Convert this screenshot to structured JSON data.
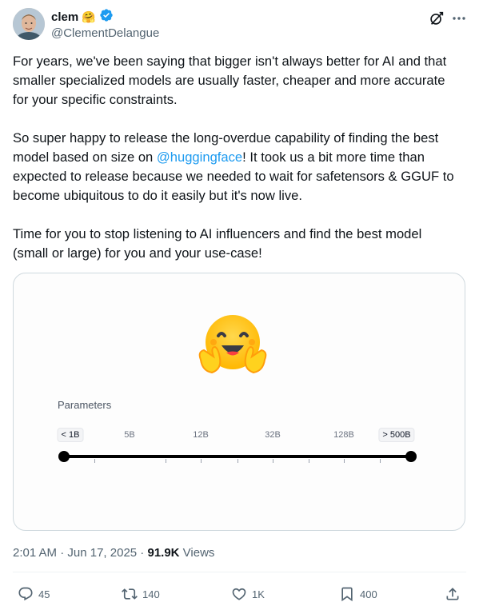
{
  "author": {
    "display_name": "clem",
    "emoji": "🤗",
    "handle": "@ClementDelangue",
    "verified": true
  },
  "tweet": {
    "paragraphs": [
      {
        "text": "For years, we've been saying that bigger isn't always better for AI and that smaller specialized models are usually faster, cheaper and more accurate for your specific constraints."
      },
      {
        "before": "So super happy to release the long-overdue capability of finding the best model based on size on ",
        "mention": "@huggingface",
        "after": "! It took us a bit more time than expected to release because we needed to wait for safetensors & GGUF to become ubiquitous to do it easily but it's now live."
      },
      {
        "text": "Time for you to stop listening to AI influencers and find the best model (small or large) for you and your use-case!"
      }
    ]
  },
  "media": {
    "title": "Parameters",
    "ticks": [
      "< 1B",
      "5B",
      "12B",
      "32B",
      "128B",
      "> 500B"
    ],
    "range_selected": [
      "< 1B",
      "> 500B"
    ]
  },
  "meta": {
    "time": "2:01 AM",
    "separator": " · ",
    "date": "Jun 17, 2025",
    "views_count": "91.9K",
    "views_label": " Views"
  },
  "actions": {
    "replies": "45",
    "reposts": "140",
    "likes": "1K",
    "bookmarks": "400"
  },
  "colors": {
    "link": "#1d9bf0",
    "secondary_text": "#536471",
    "verified": "#1d9bf0"
  },
  "icons": [
    "grok-icon",
    "more-icon",
    "reply-icon",
    "repost-icon",
    "like-icon",
    "bookmark-icon",
    "share-icon",
    "verified-badge-icon"
  ]
}
